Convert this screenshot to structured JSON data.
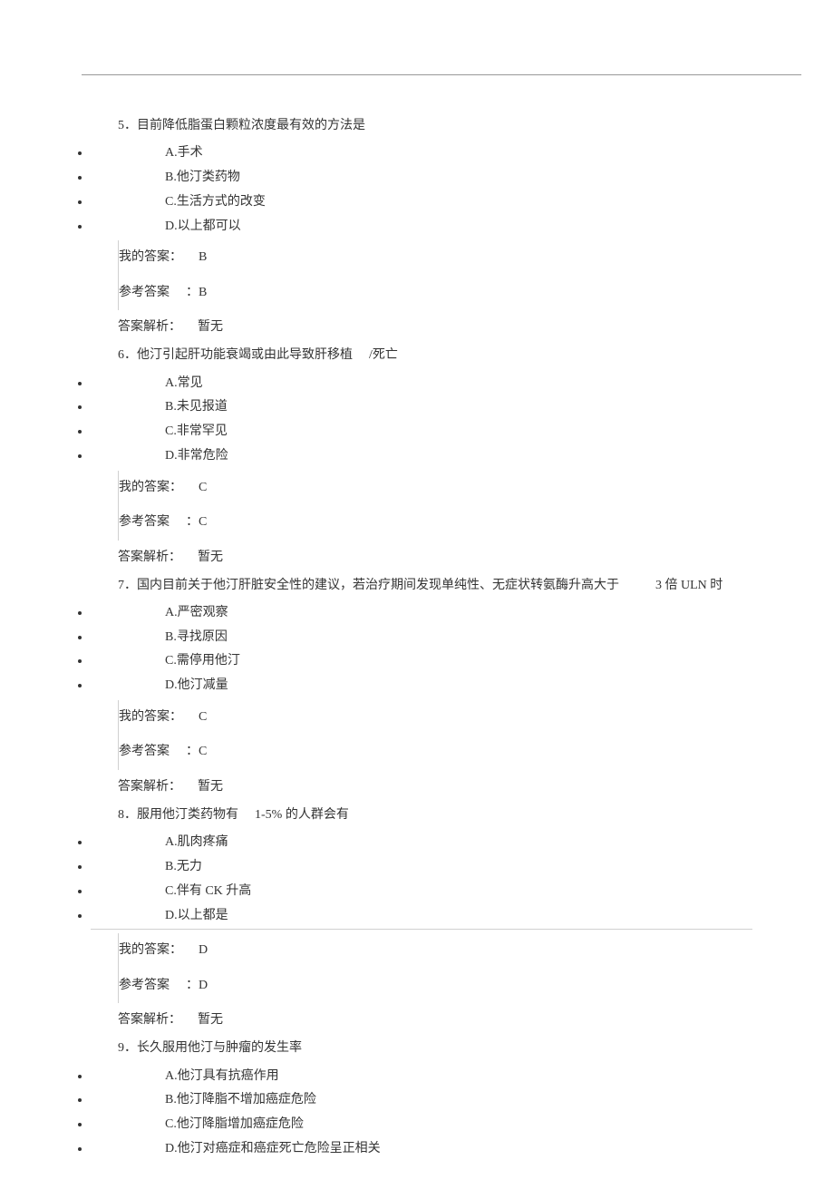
{
  "questions": [
    {
      "number": "5",
      "text": "．目前降低脂蛋白颗粒浓度最有效的方法是",
      "options": [
        "A.手术",
        "B.他汀类药物",
        "C.生活方式的改变",
        "D.以上都可以"
      ],
      "my_answer_label": "我的答案：",
      "my_answer_value": "B",
      "ref_answer_label": "参考答案",
      "ref_answer_sep": "：",
      "ref_answer_value": "B",
      "analysis_label": "答案解析：",
      "analysis_value": "暂无"
    },
    {
      "number": "6",
      "text_part1": "．他汀引起肝功能衰竭或由此导致肝移植",
      "text_part2": "/死亡",
      "options": [
        "A.常见",
        "B.未见报道",
        "C.非常罕见",
        "D.非常危险"
      ],
      "my_answer_label": "我的答案：",
      "my_answer_value": "C",
      "ref_answer_label": "参考答案",
      "ref_answer_sep": "：",
      "ref_answer_value": "C",
      "analysis_label": "答案解析：",
      "analysis_value": "暂无"
    },
    {
      "number": "7",
      "text_part1": "．国内目前关于他汀肝脏安全性的建议，若治疗期间发现单纯性、无症状转氨酶升高大于",
      "text_part2": "3 倍 ULN 时",
      "options": [
        "A.严密观察",
        "B.寻找原因",
        "C.需停用他汀",
        "D.他汀减量"
      ],
      "my_answer_label": "我的答案：",
      "my_answer_value": "C",
      "ref_answer_label": "参考答案",
      "ref_answer_sep": "：",
      "ref_answer_value": "C",
      "analysis_label": "答案解析：",
      "analysis_value": "暂无"
    },
    {
      "number": "8",
      "text_part1": "．服用他汀类药物有",
      "text_part2": "1-5% 的人群会有",
      "options": [
        "A.肌肉疼痛",
        "B.无力",
        "C.伴有 CK 升高",
        "D.以上都是"
      ],
      "my_answer_label": "我的答案：",
      "my_answer_value": "D",
      "ref_answer_label": "参考答案",
      "ref_answer_sep": "：",
      "ref_answer_value": "D",
      "analysis_label": "答案解析：",
      "analysis_value": "暂无"
    },
    {
      "number": "9",
      "text": "．长久服用他汀与肿瘤的发生率",
      "options": [
        "A.他汀具有抗癌作用",
        "B.他汀降脂不增加癌症危险",
        "C.他汀降脂增加癌症危险",
        "D.他汀对癌症和癌症死亡危险呈正相关"
      ]
    }
  ]
}
